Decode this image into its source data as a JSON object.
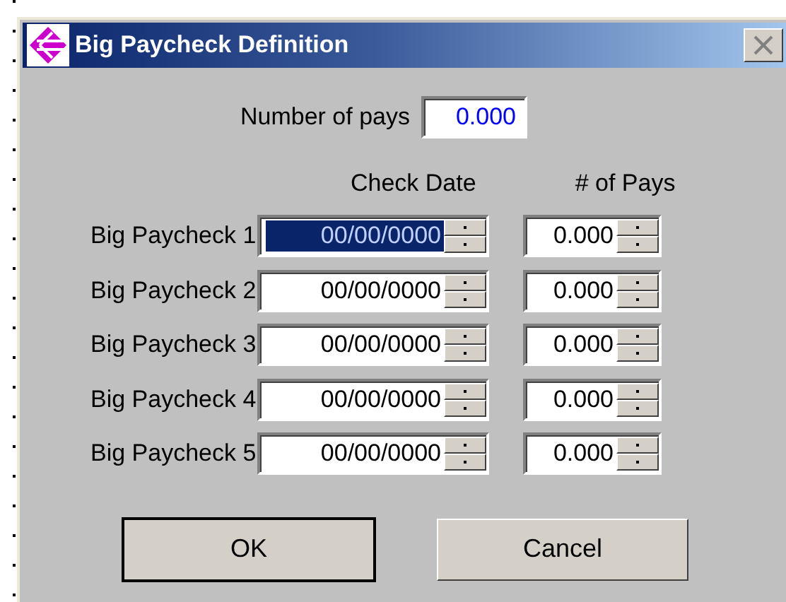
{
  "window": {
    "title": "Big Paycheck Definition"
  },
  "number_of_pays": {
    "label": "Number of pays",
    "value": "0.000"
  },
  "columns": [
    "Check Date",
    "# of Pays"
  ],
  "rows": [
    {
      "label": "Big Paycheck 1",
      "check_date": "00/00/0000",
      "pays": "0.000",
      "selected": true
    },
    {
      "label": "Big Paycheck 2",
      "check_date": "00/00/0000",
      "pays": "0.000",
      "selected": false
    },
    {
      "label": "Big Paycheck 3",
      "check_date": "00/00/0000",
      "pays": "0.000",
      "selected": false
    },
    {
      "label": "Big Paycheck 4",
      "check_date": "00/00/0000",
      "pays": "0.000",
      "selected": false
    },
    {
      "label": "Big Paycheck 5",
      "check_date": "00/00/0000",
      "pays": "0.000",
      "selected": false
    }
  ],
  "buttons": [
    {
      "label": "OK",
      "default": true
    },
    {
      "label": "Cancel",
      "default": false
    }
  ]
}
